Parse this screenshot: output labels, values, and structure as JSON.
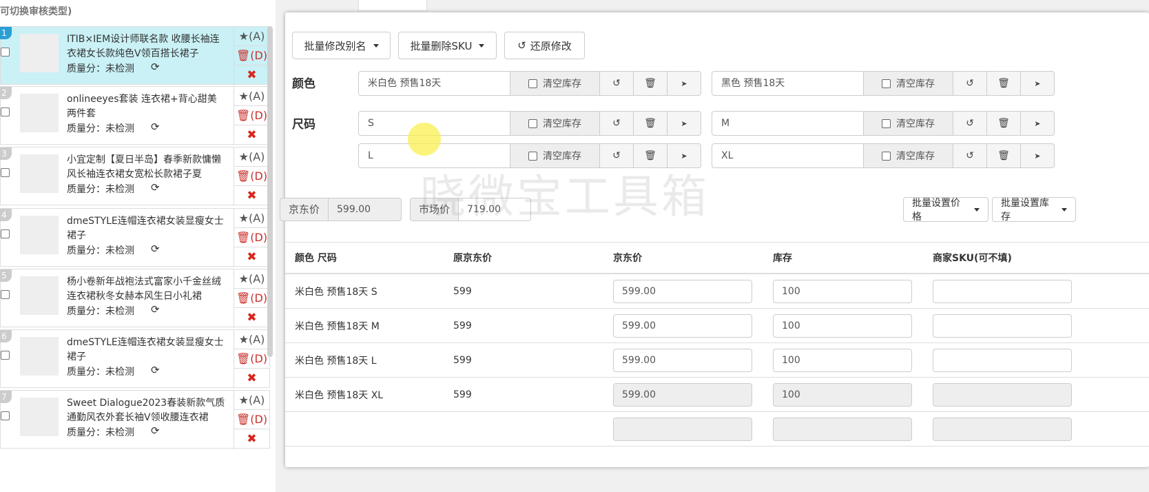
{
  "left_hint": "可切换审核类型)",
  "products": [
    {
      "num": "1",
      "title": "ITIB×IEM设计师联名款 收腰长袖连衣裙女长款纯色V领百搭长裙子",
      "quality": "质量分：未检测",
      "selected": true
    },
    {
      "num": "2",
      "title": "onlineeyes套装 连衣裙+背心甜美两件套",
      "quality": "质量分：未检测",
      "selected": false
    },
    {
      "num": "3",
      "title": "小宜定制【夏日半岛】春季新款慵懒风长袖连衣裙女宽松长款裙子夏",
      "quality": "质量分：未检测",
      "selected": false
    },
    {
      "num": "4",
      "title": "dmeSTYLE连帽连衣裙女装显瘦女士裙子",
      "quality": "质量分：未检测",
      "selected": false
    },
    {
      "num": "5",
      "title": "杨小卷新年战袍法式富家小千金丝绒连衣裙秋冬女赫本风生日小礼裙",
      "quality": "质量分：未检测",
      "selected": false
    },
    {
      "num": "6",
      "title": "dmeSTYLE连帽连衣裙女装显瘦女士裙子",
      "quality": "质量分：未检测",
      "selected": false
    },
    {
      "num": "7",
      "title": "Sweet Dialogue2023春装新款气质通勤风衣外套长袖V领收腰连衣裙",
      "quality": "质量分：未检测",
      "selected": false
    }
  ],
  "actions": {
    "star": "★(A)",
    "del": "🗑(D)",
    "close": "✖"
  },
  "toolbar": {
    "rename": "批量修改别名",
    "delete_sku": "批量删除SKU",
    "restore": "还原修改"
  },
  "attrs": {
    "color_label": "颜色",
    "size_label": "尺码",
    "clear_stock": "清空库存",
    "colors": [
      "米白色 预售18天",
      "黑色 预售18天"
    ],
    "sizes": [
      "S",
      "M",
      "L",
      "XL"
    ]
  },
  "prices": {
    "jd_label": "京东价",
    "jd_value": "599.00",
    "market_label": "市场价",
    "market_value": "719.00",
    "batch_price": "批量设置价格",
    "batch_stock": "批量设置库存"
  },
  "table": {
    "headers": [
      "颜色 尺码",
      "原京东价",
      "京东价",
      "库存",
      "商家SKU(可不填)"
    ],
    "rows": [
      {
        "name": "米白色 预售18天 S",
        "orig": "599",
        "price": "599.00",
        "stock": "100",
        "sku": ""
      },
      {
        "name": "米白色 预售18天 M",
        "orig": "599",
        "price": "599.00",
        "stock": "100",
        "sku": ""
      },
      {
        "name": "米白色 预售18天 L",
        "orig": "599",
        "price": "599.00",
        "stock": "100",
        "sku": ""
      },
      {
        "name": "米白色 预售18天 XL",
        "orig": "599",
        "price": "599.00",
        "stock": "100",
        "sku": ""
      }
    ]
  },
  "watermark": "晓微宝工具箱"
}
